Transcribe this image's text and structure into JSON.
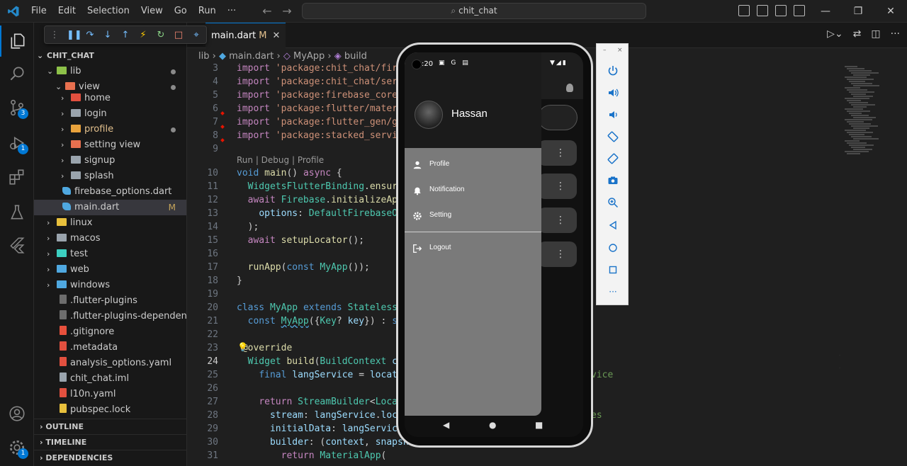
{
  "titlebar": {
    "menu": [
      "File",
      "Edit",
      "Selection",
      "View",
      "Go",
      "Run",
      "···"
    ],
    "search_text": "chit_chat"
  },
  "activity": {
    "source_control_badge": "3",
    "debug_badge": "1",
    "accounts_badge": "1"
  },
  "explorer": {
    "root": "CHIT_CHAT",
    "tree": [
      {
        "label": "lib",
        "type": "folder-open",
        "color": "#8dc149",
        "dot": true
      },
      {
        "label": "view",
        "type": "folder-open",
        "color": "#e8704f",
        "dot": true
      },
      {
        "label": "home",
        "type": "folder",
        "color": "#e2503f"
      },
      {
        "label": "login",
        "type": "folder",
        "color": "#9aa4ad"
      },
      {
        "label": "profile",
        "type": "folder",
        "color": "#e8a23c",
        "dot": true
      },
      {
        "label": "setting view",
        "type": "folder",
        "color": "#e8704f"
      },
      {
        "label": "signup",
        "type": "folder",
        "color": "#9aa4ad"
      },
      {
        "label": "splash",
        "type": "folder",
        "color": "#9aa4ad"
      },
      {
        "label": "firebase_options.dart",
        "type": "dart",
        "color": "#4fa8e0"
      },
      {
        "label": "main.dart",
        "type": "dart",
        "color": "#4fa8e0",
        "modified": "M"
      },
      {
        "label": "linux",
        "type": "folder",
        "color": "#e8c03c"
      },
      {
        "label": "macos",
        "type": "folder",
        "color": "#9aa4ad"
      },
      {
        "label": "test",
        "type": "folder",
        "color": "#3ccfc0"
      },
      {
        "label": "web",
        "type": "folder",
        "color": "#4fa8e0"
      },
      {
        "label": "windows",
        "type": "folder",
        "color": "#4fa8e0"
      },
      {
        "label": ".flutter-plugins",
        "type": "file",
        "color": "#6d6d6d"
      },
      {
        "label": ".flutter-plugins-dependen...",
        "type": "file",
        "color": "#6d6d6d"
      },
      {
        "label": ".gitignore",
        "type": "file",
        "color": "#e8503c"
      },
      {
        "label": ".metadata",
        "type": "file",
        "color": "#e2503f"
      },
      {
        "label": "analysis_options.yaml",
        "type": "file",
        "color": "#e2503f"
      },
      {
        "label": "chit_chat.iml",
        "type": "file",
        "color": "#9aa4ad"
      },
      {
        "label": "l10n.yaml",
        "type": "file",
        "color": "#e2503f"
      },
      {
        "label": "pubspec.lock",
        "type": "file",
        "color": "#e8c03c"
      }
    ],
    "sections": [
      "OUTLINE",
      "TIMELINE",
      "DEPENDENCIES"
    ]
  },
  "editor": {
    "tab_label": "main.dart",
    "tab_modified": "M",
    "breadcrumb": {
      "folder": "lib",
      "file": "main.dart",
      "class": "MyApp",
      "method": "build"
    },
    "codelens": "Run | Debug | Profile",
    "line_numbers": [
      "3",
      "4",
      "5",
      "6",
      "7",
      "8",
      "9",
      "10",
      "11",
      "12",
      "13",
      "14",
      "15",
      "16",
      "17",
      "18",
      "19",
      "20",
      "21",
      "22",
      "23",
      "24",
      "25",
      "26",
      "27",
      "28",
      "29",
      "30",
      "31"
    ],
    "current_line": "24",
    "trailing_fragments": {
      "line25": "vice",
      "line28": "es"
    }
  },
  "phone": {
    "status_time": ":20",
    "status_icons": "▣ G ▤",
    "status_right": "▼◢▮",
    "username": "Hassan",
    "drawer_items": [
      {
        "label": "Profile",
        "icon": "person-icon"
      },
      {
        "label": "Notification",
        "icon": "bell-icon"
      },
      {
        "label": "Setting",
        "icon": "gear-icon"
      },
      {
        "label": "Logout",
        "icon": "logout-icon"
      }
    ],
    "nav": {
      "back": "◀",
      "home": "●",
      "recents": "■"
    }
  },
  "emulator_tools": {
    "minimize": "–",
    "close": "×",
    "more": "···"
  }
}
